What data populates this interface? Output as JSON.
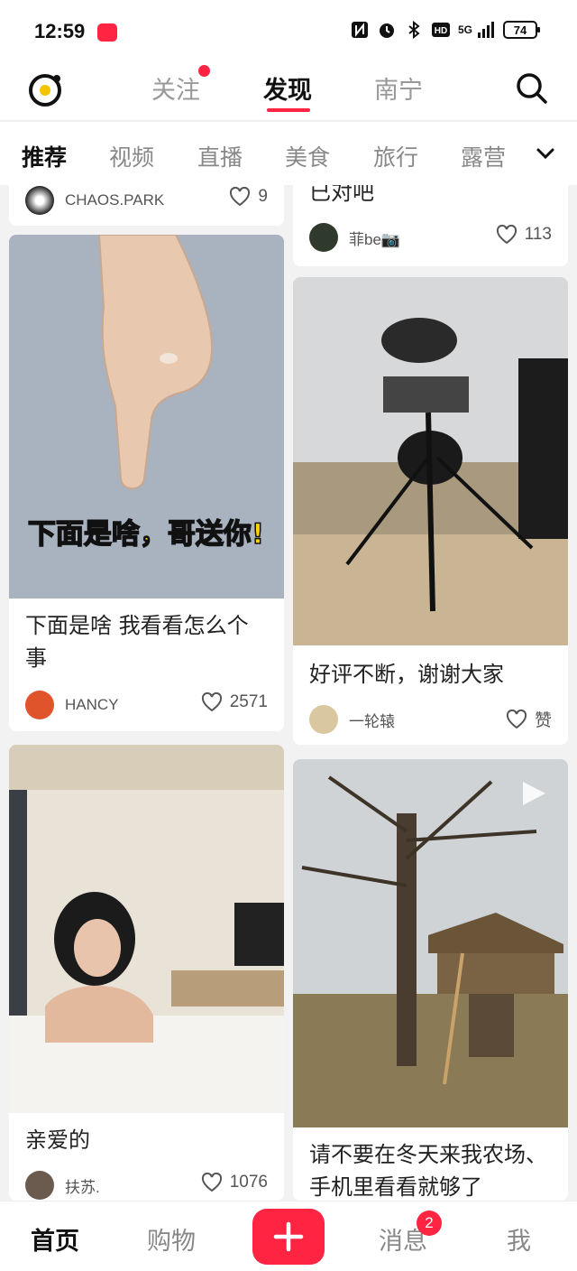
{
  "status_bar": {
    "time": "12:59",
    "network": "5G",
    "battery": "74",
    "icons": [
      "nfc-icon",
      "alarm-icon",
      "bluetooth-icon",
      "hd-icon",
      "signal-icon",
      "battery-icon"
    ]
  },
  "top_nav": {
    "tabs": [
      {
        "label": "关注",
        "has_dot": true
      },
      {
        "label": "发现",
        "active": true
      },
      {
        "label": "南宁"
      }
    ]
  },
  "categories": {
    "items": [
      "推荐",
      "视频",
      "直播",
      "美食",
      "旅行",
      "露营"
    ],
    "active": "推荐"
  },
  "feed": {
    "left": [
      {
        "title": "",
        "author": "CHAOS.PARK",
        "likes": "9"
      },
      {
        "title": "下面是啥 我看看怎么个事",
        "image_caption": "下面是啥，哥送你!",
        "author": "HANCY",
        "likes": "2571"
      },
      {
        "title": "亲爱的",
        "author": "扶苏.",
        "likes": "1076"
      }
    ],
    "right": [
      {
        "title": "已对吧",
        "author": "菲be📷",
        "likes": "113"
      },
      {
        "title": "好评不断，谢谢大家",
        "author": "一轮辕",
        "likes": "赞"
      },
      {
        "title": "请不要在冬天来我农场、手机里看看就够了",
        "author": "",
        "likes": ""
      }
    ]
  },
  "bottom_nav": {
    "home": "首页",
    "shop": "购物",
    "plus": "+",
    "messages": "消息",
    "messages_badge": "2",
    "me": "我"
  },
  "colors": {
    "accent": "#ff2442",
    "text": "#222222",
    "muted": "#888888",
    "background": "#f2f2f2"
  }
}
